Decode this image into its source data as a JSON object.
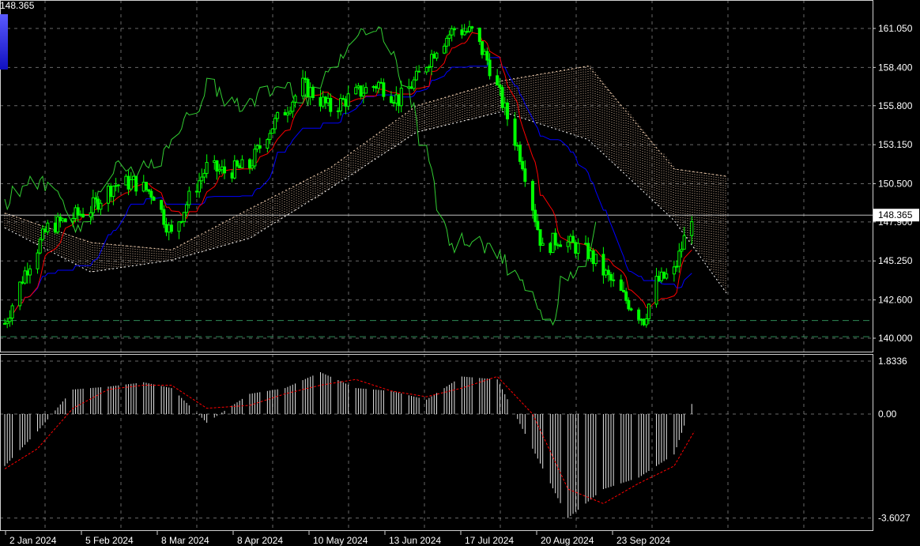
{
  "window": {
    "current_price_label": "148.365"
  },
  "colors": {
    "background": "#000000",
    "candle": "#00ff00",
    "tenkan": "#ff0000",
    "kijun": "#0000ff",
    "chikou": "#32cd32",
    "cloud_up": "#ffdab9",
    "cloud_down": "#ffffff",
    "histogram": "#ffffff",
    "signal": "#ff0000",
    "level_lines": "#2e8b57",
    "price_line": "#c0c0c0"
  },
  "chart_data": [
    {
      "type": "candlestick",
      "title": "",
      "indicators": [
        "Ichimoku Kinko Hyo (Tenkan red, Kijun blue, Chikou green, Kumo dotted)"
      ],
      "ylim": [
        139.2,
        163.0
      ],
      "y_ticks": [
        161.05,
        158.4,
        155.8,
        153.15,
        150.5,
        147.9,
        145.25,
        142.6,
        140.0
      ],
      "y_tick_labels": [
        "161.050",
        "158.400",
        "155.800",
        "153.150",
        "150.500",
        "147.900",
        "145.250",
        "142.600",
        "140.000"
      ],
      "current_price": 148.365,
      "current_price_label": "148.365",
      "horizontal_levels": [
        141.2,
        140.1
      ],
      "x_tick_labels": [
        "2 Jan 2024",
        "5 Feb 2024",
        "8 Mar 2024",
        "8 Apr 2024",
        "10 May 2024",
        "13 Jun 2024",
        "17 Jul 2024",
        "20 Aug 2024",
        "23 Sep 2024"
      ],
      "close_path": {
        "dates": [
          "2024-01-02",
          "2024-01-10",
          "2024-01-19",
          "2024-01-26",
          "2024-02-05",
          "2024-02-14",
          "2024-02-22",
          "2024-03-01",
          "2024-03-08",
          "2024-03-15",
          "2024-03-22",
          "2024-03-29",
          "2024-04-08",
          "2024-04-15",
          "2024-04-22",
          "2024-04-29",
          "2024-05-10",
          "2024-05-20",
          "2024-05-29",
          "2024-06-06",
          "2024-06-13",
          "2024-06-21",
          "2024-06-28",
          "2024-07-05",
          "2024-07-11",
          "2024-07-17",
          "2024-07-25",
          "2024-08-02",
          "2024-08-08",
          "2024-08-20",
          "2024-08-27",
          "2024-09-04",
          "2024-09-11",
          "2024-09-16",
          "2024-09-23",
          "2024-09-30"
        ],
        "close": [
          141.0,
          144.5,
          147.5,
          148.0,
          148.8,
          150.4,
          150.6,
          149.8,
          147.0,
          149.5,
          151.6,
          151.3,
          151.7,
          154.0,
          155.5,
          157.2,
          155.6,
          156.6,
          157.3,
          156.2,
          157.6,
          159.8,
          161.0,
          160.8,
          158.9,
          156.0,
          152.0,
          146.0,
          146.8,
          145.8,
          144.3,
          142.6,
          141.3,
          143.8,
          144.5,
          148.4
        ]
      },
      "cloud_span_a": {
        "dates": [
          "2024-01-02",
          "2024-02-05",
          "2024-03-08",
          "2024-04-08",
          "2024-05-10",
          "2024-06-13",
          "2024-07-17",
          "2024-08-20",
          "2024-09-23",
          "2024-10-14"
        ],
        "values": [
          148.5,
          146.5,
          146.0,
          148.8,
          151.6,
          155.8,
          157.5,
          158.5,
          151.5,
          151.0
        ]
      },
      "cloud_span_b": {
        "dates": [
          "2024-01-02",
          "2024-02-05",
          "2024-03-08",
          "2024-04-08",
          "2024-05-10",
          "2024-06-13",
          "2024-07-17",
          "2024-08-20",
          "2024-09-23",
          "2024-10-14"
        ],
        "values": [
          147.5,
          144.5,
          145.3,
          146.8,
          150.2,
          154.0,
          155.4,
          153.5,
          148.0,
          143.0
        ]
      }
    },
    {
      "type": "bar",
      "title": "",
      "indicator": "MACD histogram with signal line",
      "ylim": [
        -3.6027,
        1.8336
      ],
      "y_ticks": [
        1.8336,
        0.0,
        -3.6027
      ],
      "y_tick_labels": [
        "1.8336",
        "0.00",
        "-3.6027"
      ],
      "histogram": {
        "dates": [
          "2024-01-02",
          "2024-01-15",
          "2024-01-29",
          "2024-02-12",
          "2024-02-26",
          "2024-03-08",
          "2024-03-22",
          "2024-04-08",
          "2024-04-22",
          "2024-05-06",
          "2024-05-20",
          "2024-06-03",
          "2024-06-17",
          "2024-07-01",
          "2024-07-15",
          "2024-07-29",
          "2024-08-12",
          "2024-08-26",
          "2024-09-09",
          "2024-09-23",
          "2024-10-01"
        ],
        "values": [
          -1.8,
          -0.6,
          0.85,
          0.95,
          1.1,
          0.9,
          -0.3,
          0.7,
          0.9,
          1.45,
          0.9,
          0.8,
          0.5,
          1.3,
          1.2,
          -1.2,
          -3.6,
          -2.6,
          -2.2,
          -1.4,
          0.6
        ]
      },
      "signal": {
        "dates": [
          "2024-01-02",
          "2024-01-15",
          "2024-01-29",
          "2024-02-12",
          "2024-02-26",
          "2024-03-08",
          "2024-03-22",
          "2024-04-08",
          "2024-04-22",
          "2024-05-06",
          "2024-05-20",
          "2024-06-03",
          "2024-06-17",
          "2024-07-01",
          "2024-07-15",
          "2024-07-29",
          "2024-08-12",
          "2024-08-26",
          "2024-09-09",
          "2024-09-23",
          "2024-10-01"
        ],
        "values": [
          -1.9,
          -1.2,
          0.2,
          0.85,
          1.0,
          1.0,
          0.2,
          0.3,
          0.7,
          1.0,
          1.2,
          0.8,
          0.6,
          0.9,
          1.3,
          0.0,
          -2.6,
          -3.1,
          -2.4,
          -1.8,
          -0.6
        ]
      }
    }
  ]
}
